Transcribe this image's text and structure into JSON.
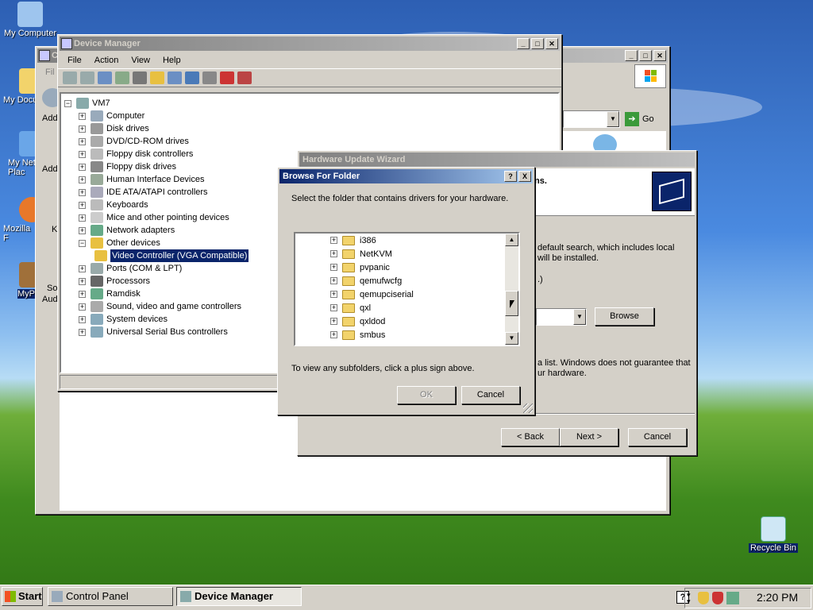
{
  "desktop": {
    "icons": [
      {
        "label": "My Computer",
        "icon": "computer-icon"
      },
      {
        "label": "My Docu",
        "icon": "documents-icon"
      },
      {
        "label": "My Net Plac",
        "icon": "network-icon"
      },
      {
        "label": "Mozilla F",
        "icon": "firefox-icon"
      },
      {
        "label": "MyP",
        "icon": "app-icon"
      },
      {
        "label": "Recycle Bin",
        "icon": "recycle-bin-icon"
      }
    ]
  },
  "control_panel": {
    "title": "C",
    "menu_first": "Fil",
    "address_label": "Add",
    "go_label": "Go",
    "sidebar_texts": [
      "Add",
      "K",
      "So",
      "Aud"
    ]
  },
  "device_manager": {
    "title": "Device Manager",
    "menu": [
      "File",
      "Action",
      "View",
      "Help"
    ],
    "tree_root": "VM7",
    "tree_items": [
      {
        "label": "Computer",
        "icon": "computer-icon"
      },
      {
        "label": "Disk drives",
        "icon": "disk-icon"
      },
      {
        "label": "DVD/CD-ROM drives",
        "icon": "dvd-icon"
      },
      {
        "label": "Floppy disk controllers",
        "icon": "floppy-controller-icon"
      },
      {
        "label": "Floppy disk drives",
        "icon": "floppy-icon"
      },
      {
        "label": "Human Interface Devices",
        "icon": "hid-icon"
      },
      {
        "label": "IDE ATA/ATAPI controllers",
        "icon": "ide-icon"
      },
      {
        "label": "Keyboards",
        "icon": "keyboard-icon"
      },
      {
        "label": "Mice and other pointing devices",
        "icon": "mouse-icon"
      },
      {
        "label": "Network adapters",
        "icon": "network-adapter-icon"
      },
      {
        "label": "Other devices",
        "icon": "unknown-device-icon"
      },
      {
        "label": "Video Controller (VGA Compatible)",
        "icon": "unknown-device-icon"
      },
      {
        "label": "Ports (COM & LPT)",
        "icon": "port-icon"
      },
      {
        "label": "Processors",
        "icon": "processor-icon"
      },
      {
        "label": "Ramdisk",
        "icon": "ramdisk-icon"
      },
      {
        "label": "Sound, video and game controllers",
        "icon": "sound-icon"
      },
      {
        "label": "System devices",
        "icon": "system-icon"
      },
      {
        "label": "Universal Serial Bus controllers",
        "icon": "usb-icon"
      }
    ]
  },
  "hardware_wizard": {
    "title": "Hardware Update Wizard",
    "header_fragment": "ns.",
    "text1": "default search, which includes local",
    "text2": "will be installed.",
    "text3": ".)",
    "browse_label": "Browse",
    "text4": "a list.  Windows does not guarantee that",
    "text5": "ur hardware.",
    "back_label": "< Back",
    "next_label": "Next >",
    "cancel_label": "Cancel"
  },
  "browse_dialog": {
    "title": "Browse For Folder",
    "help_label": "?",
    "close_label": "X",
    "instruction": "Select the folder that contains drivers for your hardware.",
    "folders": [
      "i386",
      "NetKVM",
      "pvpanic",
      "qemufwcfg",
      "qemupciserial",
      "qxl",
      "qxldod",
      "smbus"
    ],
    "hint": "To view any subfolders, click a plus sign above.",
    "ok_label": "OK",
    "cancel_label": "Cancel"
  },
  "taskbar": {
    "start_label": "Start",
    "tasks": [
      {
        "label": "Control Panel",
        "active": false
      },
      {
        "label": "Device Manager",
        "active": true
      }
    ],
    "clock": "2:20 PM"
  }
}
